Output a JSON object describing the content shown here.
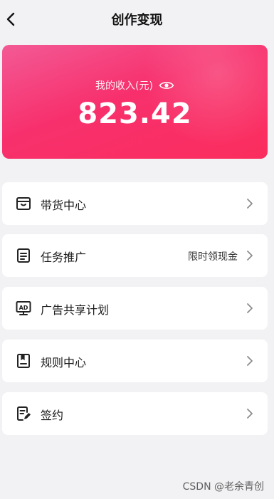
{
  "nav": {
    "title": "创作变现",
    "back_icon": "chevron-left-icon"
  },
  "income": {
    "label": "我的收入(元)",
    "amount": "823.42",
    "eye_icon": "eye-icon",
    "gradient_start": "#f35a95",
    "gradient_end": "#fb2d5d"
  },
  "menu": {
    "items": [
      {
        "label": "带货中心",
        "extra": "",
        "icon": "store-box-icon"
      },
      {
        "label": "任务推广",
        "extra": "限时领现金",
        "icon": "task-document-icon"
      },
      {
        "label": "广告共享计划",
        "extra": "",
        "icon": "ad-monitor-icon"
      },
      {
        "label": "规则中心",
        "extra": "",
        "icon": "rules-book-icon"
      },
      {
        "label": "签约",
        "extra": "",
        "icon": "sign-contract-icon"
      }
    ]
  },
  "watermark": "CSDN @老余青创"
}
